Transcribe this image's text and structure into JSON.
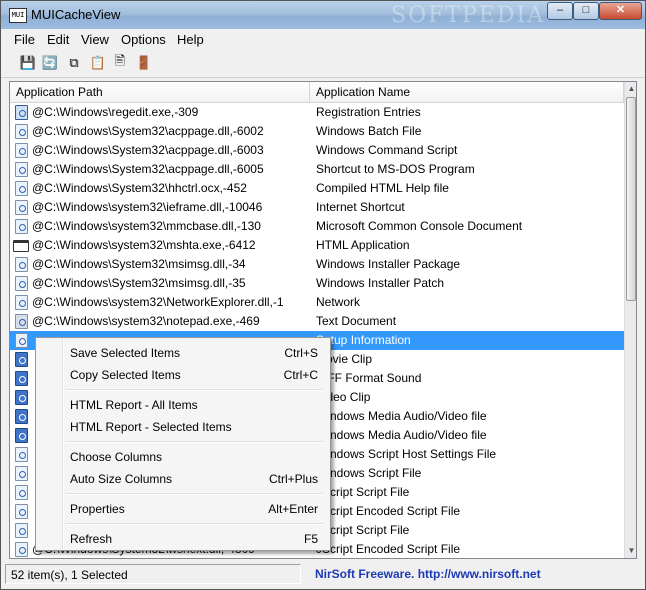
{
  "window": {
    "title": "MUICacheView",
    "icon_text": "MUI",
    "watermark": "SOFTPEDIA"
  },
  "menu": [
    "File",
    "Edit",
    "View",
    "Options",
    "Help"
  ],
  "toolbar": [
    {
      "name": "save-icon",
      "glyph": "💾"
    },
    {
      "name": "refresh-icon",
      "glyph": "🔄"
    },
    {
      "name": "copy-icon",
      "glyph": "⧉"
    },
    {
      "name": "properties-icon",
      "glyph": "📋"
    },
    {
      "name": "html-report-icon",
      "glyph": "🖹"
    },
    {
      "name": "exit-icon",
      "glyph": "🚪"
    }
  ],
  "columns": [
    "Application Path",
    "Application Name"
  ],
  "rows": [
    {
      "path": "@C:\\Windows\\regedit.exe,-309",
      "name": "Registration Entries",
      "icon": "reg"
    },
    {
      "path": "@C:\\Windows\\System32\\acppage.dll,-6002",
      "name": "Windows Batch File",
      "icon": "doc"
    },
    {
      "path": "@C:\\Windows\\System32\\acppage.dll,-6003",
      "name": "Windows Command Script",
      "icon": "doc"
    },
    {
      "path": "@C:\\Windows\\System32\\acppage.dll,-6005",
      "name": "Shortcut to MS-DOS Program",
      "icon": "doc"
    },
    {
      "path": "@C:\\Windows\\System32\\hhctrl.ocx,-452",
      "name": "Compiled HTML Help file",
      "icon": "doc"
    },
    {
      "path": "@C:\\Windows\\system32\\ieframe.dll,-10046",
      "name": "Internet Shortcut",
      "icon": "doc"
    },
    {
      "path": "@C:\\Windows\\system32\\mmcbase.dll,-130",
      "name": "Microsoft Common Console Document",
      "icon": "doc"
    },
    {
      "path": "@C:\\Windows\\system32\\mshta.exe,-6412",
      "name": "HTML Application",
      "icon": "win"
    },
    {
      "path": "@C:\\Windows\\System32\\msimsg.dll,-34",
      "name": "Windows Installer Package",
      "icon": "doc"
    },
    {
      "path": "@C:\\Windows\\System32\\msimsg.dll,-35",
      "name": "Windows Installer Patch",
      "icon": "doc"
    },
    {
      "path": "@C:\\Windows\\system32\\NetworkExplorer.dll,-1",
      "name": "Network",
      "icon": "doc"
    },
    {
      "path": "@C:\\Windows\\system32\\notepad.exe,-469",
      "name": "Text Document",
      "icon": "np"
    },
    {
      "path": "",
      "name": "Setup Information",
      "icon": "doc",
      "selected": true
    },
    {
      "path": "",
      "name": "Movie Clip",
      "icon": "net"
    },
    {
      "path": "",
      "name": "AIFF Format Sound",
      "icon": "net"
    },
    {
      "path": "",
      "name": "Video Clip",
      "icon": "net"
    },
    {
      "path": "",
      "name": "Windows Media Audio/Video file",
      "icon": "net"
    },
    {
      "path": "",
      "name": "Windows Media Audio/Video file",
      "icon": "net"
    },
    {
      "path": "",
      "name": "Windows Script Host Settings File",
      "icon": "doc"
    },
    {
      "path": "",
      "name": "Windows Script File",
      "icon": "doc"
    },
    {
      "path": "",
      "name": "JScript Script File",
      "icon": "doc"
    },
    {
      "path": "",
      "name": "JScript Encoded Script File",
      "icon": "doc"
    },
    {
      "path": "",
      "name": "JScript Script File",
      "icon": "doc"
    },
    {
      "path": "@C:\\Windows\\System32\\wshext.dll,-4809",
      "name": "JScript Encoded Script File",
      "icon": "doc"
    }
  ],
  "context_menu": [
    {
      "label": "Save Selected Items",
      "shortcut": "Ctrl+S",
      "name": "menu-save-selected"
    },
    {
      "label": "Copy Selected Items",
      "shortcut": "Ctrl+C",
      "name": "menu-copy-selected"
    },
    {
      "sep": true
    },
    {
      "label": "HTML Report - All Items",
      "shortcut": "",
      "name": "menu-html-report-all"
    },
    {
      "label": "HTML Report - Selected Items",
      "shortcut": "",
      "name": "menu-html-report-selected"
    },
    {
      "sep": true
    },
    {
      "label": "Choose Columns",
      "shortcut": "",
      "name": "menu-choose-columns"
    },
    {
      "label": "Auto Size Columns",
      "shortcut": "Ctrl+Plus",
      "name": "menu-auto-size-columns"
    },
    {
      "sep": true
    },
    {
      "label": "Properties",
      "shortcut": "Alt+Enter",
      "name": "menu-properties"
    },
    {
      "sep": true
    },
    {
      "label": "Refresh",
      "shortcut": "F5",
      "name": "menu-refresh"
    }
  ],
  "status": {
    "count": "52 item(s), 1 Selected",
    "credit": "NirSoft Freeware.  http://www.nirsoft.net"
  }
}
